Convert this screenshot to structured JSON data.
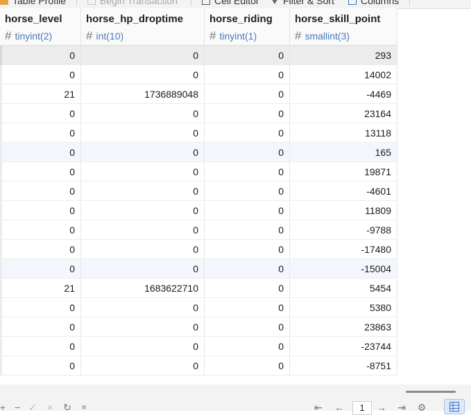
{
  "toolbar": {
    "items": [
      {
        "label": "Table Profile",
        "dim": false
      },
      {
        "label": "Begin Transaction",
        "dim": true
      },
      {
        "label": "Cell Editor",
        "dim": false
      },
      {
        "label": "Filter & Sort",
        "dim": false
      },
      {
        "label": "Columns",
        "dim": false
      }
    ]
  },
  "columns": [
    {
      "name": "horse_level",
      "type": "tinyint(2)"
    },
    {
      "name": "horse_hp_droptime",
      "type": "int(10)"
    },
    {
      "name": "horse_riding",
      "type": "tinyint(1)"
    },
    {
      "name": "horse_skill_point",
      "type": "smallint(3)"
    }
  ],
  "type_icon": "#",
  "rows": [
    [
      "0",
      "0",
      "0",
      "293"
    ],
    [
      "0",
      "0",
      "0",
      "14002"
    ],
    [
      "21",
      "1736889048",
      "0",
      "-4469"
    ],
    [
      "0",
      "0",
      "0",
      "23164"
    ],
    [
      "0",
      "0",
      "0",
      "13118"
    ],
    [
      "0",
      "0",
      "0",
      "165"
    ],
    [
      "0",
      "0",
      "0",
      "19871"
    ],
    [
      "0",
      "0",
      "0",
      "-4601"
    ],
    [
      "0",
      "0",
      "0",
      "11809"
    ],
    [
      "0",
      "0",
      "0",
      "-9788"
    ],
    [
      "0",
      "0",
      "0",
      "-17480"
    ],
    [
      "0",
      "0",
      "0",
      "-15004"
    ],
    [
      "21",
      "1683622710",
      "0",
      "5454"
    ],
    [
      "0",
      "0",
      "0",
      "5380"
    ],
    [
      "0",
      "0",
      "0",
      "23863"
    ],
    [
      "0",
      "0",
      "0",
      "-23744"
    ],
    [
      "0",
      "0",
      "0",
      "-8751"
    ]
  ],
  "selected_row": 0,
  "highlight_rows": [
    5,
    11
  ],
  "footer": {
    "add": "+",
    "remove": "−",
    "apply": "✓",
    "discard": "×",
    "refresh": "↻",
    "stop": "■",
    "first": "⇤",
    "prev": "←",
    "page": "1",
    "next": "→",
    "last": "⇥",
    "settings": "⚙"
  },
  "colors": {
    "accent": "#4a78b8",
    "selected_row": "#ececec",
    "highlight_row": "#f3f7fd"
  }
}
